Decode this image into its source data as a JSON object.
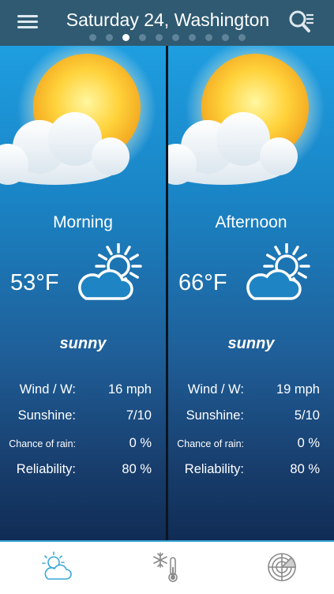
{
  "header": {
    "title": "Saturday 24, Washington",
    "page_count": 10,
    "active_page": 3,
    "menu_icon": "hamburger-icon",
    "search_icon": "search-list-icon"
  },
  "panels": [
    {
      "period": "Morning",
      "temperature": "53°F",
      "condition": "sunny",
      "condition_icon": "partly-sunny-icon",
      "rows": [
        {
          "label": "Wind / W:",
          "value": "16 mph"
        },
        {
          "label": "Sunshine:",
          "value": "7/10"
        },
        {
          "label": "Chance of rain:",
          "value": "0 %"
        },
        {
          "label": "Reliability:",
          "value": "80 %"
        }
      ]
    },
    {
      "period": "Afternoon",
      "temperature": "66°F",
      "condition": "sunny",
      "condition_icon": "partly-sunny-icon",
      "rows": [
        {
          "label": "Wind / W:",
          "value": "19 mph"
        },
        {
          "label": "Sunshine:",
          "value": "5/10"
        },
        {
          "label": "Chance of rain:",
          "value": "0 %"
        },
        {
          "label": "Reliability:",
          "value": "80 %"
        }
      ]
    }
  ],
  "tabs": [
    {
      "icon": "weather-forecast-icon",
      "active": true
    },
    {
      "icon": "snow-temperature-icon",
      "active": false
    },
    {
      "icon": "radar-icon",
      "active": false
    }
  ],
  "colors": {
    "header_bg": "#2f5a72",
    "accent": "#3aa7d8",
    "sun": "#ffd23a"
  }
}
